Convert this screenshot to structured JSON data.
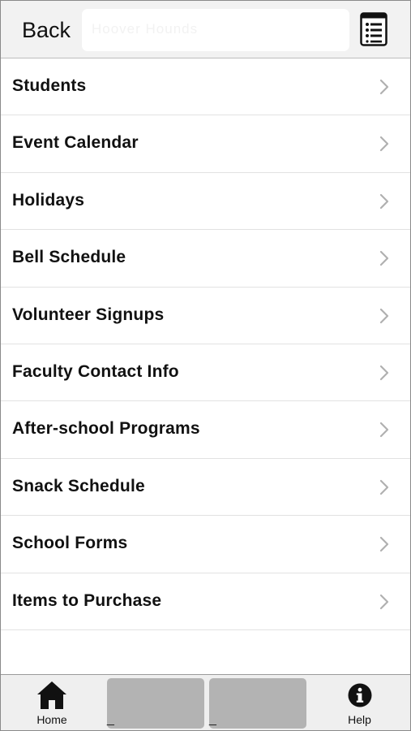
{
  "header": {
    "back_label": "Back",
    "title": "Hoover Hounds"
  },
  "list": {
    "items": [
      {
        "label": "Students"
      },
      {
        "label": "Event Calendar"
      },
      {
        "label": "Holidays"
      },
      {
        "label": "Bell Schedule"
      },
      {
        "label": "Volunteer Signups"
      },
      {
        "label": "Faculty Contact Info"
      },
      {
        "label": "After-school Programs"
      },
      {
        "label": "Snack Schedule"
      },
      {
        "label": "School Forms"
      },
      {
        "label": "Items to Purchase"
      }
    ]
  },
  "tabbar": {
    "home_label": "Home",
    "slot2_label": "_",
    "slot3_label": "_",
    "help_label": "Help"
  },
  "icons": {
    "menu": "list-menu-icon",
    "chevron": "chevron-right-icon",
    "home": "home-icon",
    "help": "info-icon"
  },
  "colors": {
    "header_bg": "#f2f2f2",
    "tabbar_bg": "#efefef",
    "placeholder_tab": "#b3b3b3",
    "chevron": "#b0b0b0"
  }
}
